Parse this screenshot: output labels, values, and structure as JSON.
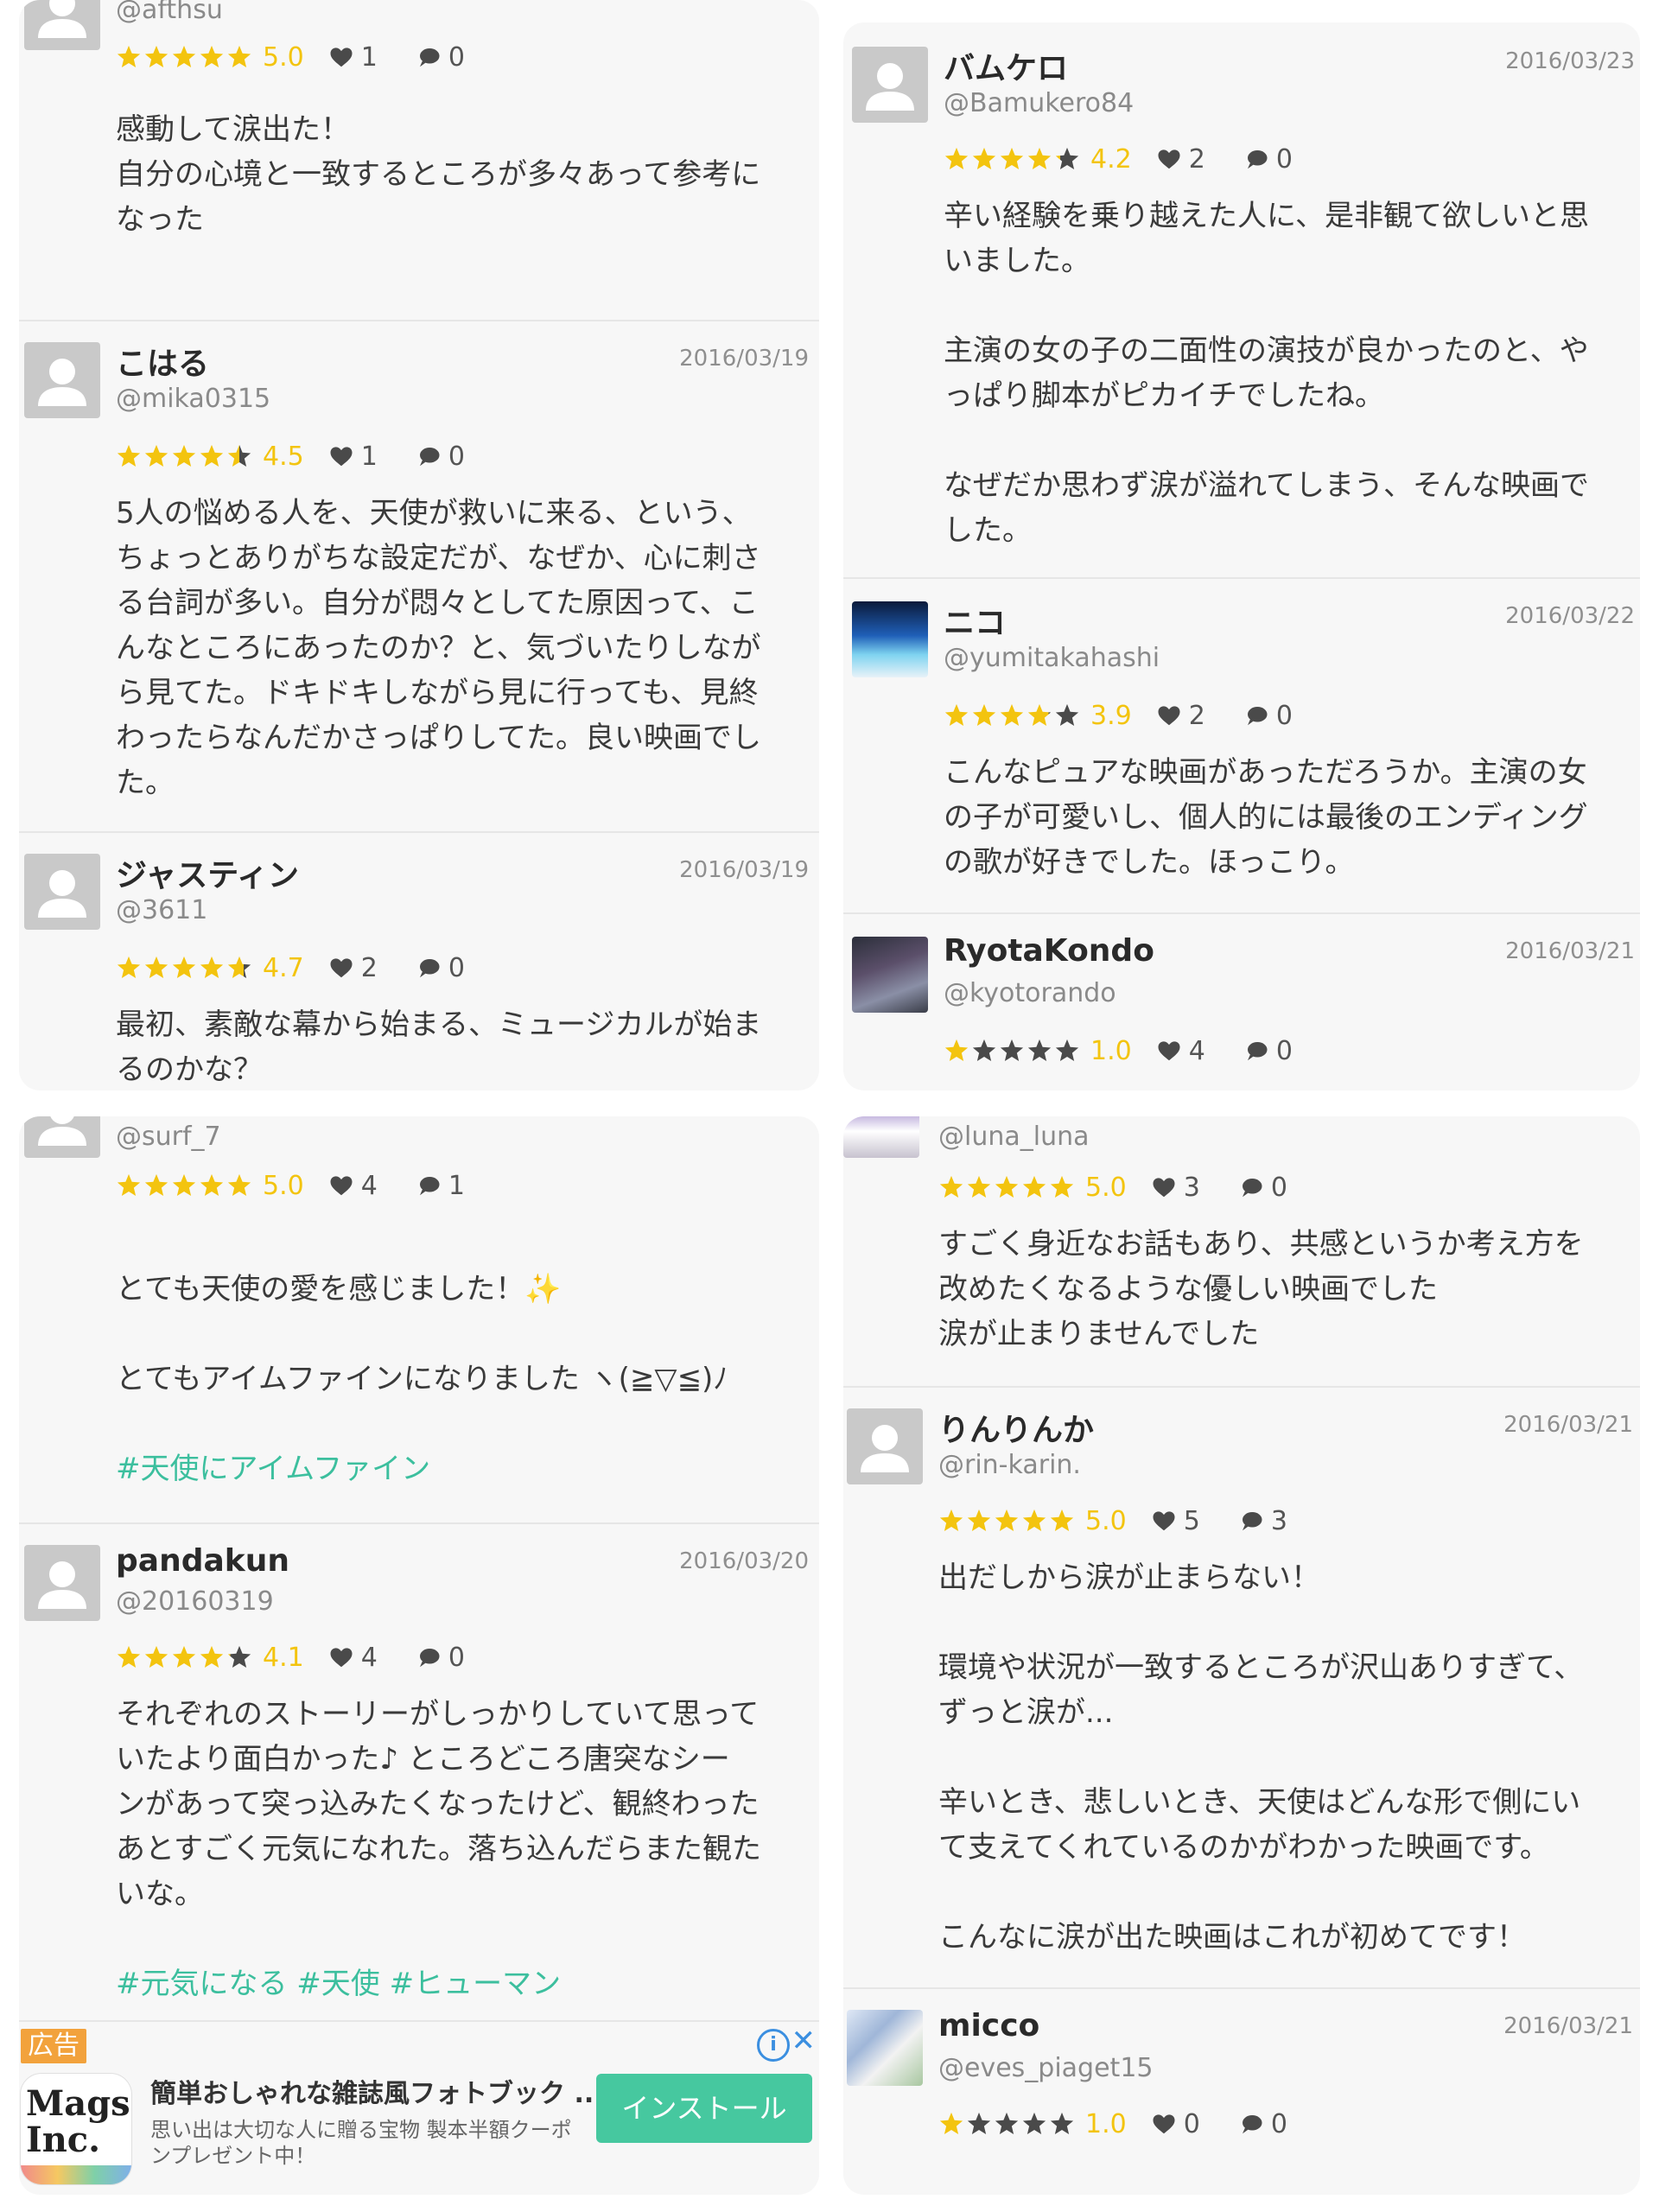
{
  "colors": {
    "star": "#f3c40f",
    "star_empty": "#4a4a4a",
    "hashtag": "#3cbf9e",
    "install": "#46c89f",
    "ad_badge": "#f2a23c"
  },
  "panels": [
    {
      "reviews": [
        {
          "handle": "@afthsu",
          "rating": 5.0,
          "score": "5.0",
          "likes": "1",
          "comments": "0",
          "body": [
            "感動して涙出た！",
            "自分の心境と一致するところが多々あって参考に",
            "なった"
          ]
        },
        {
          "name": "こはる",
          "handle": "@mika0315",
          "date": "2016/03/19",
          "rating": 4.5,
          "score": "4.5",
          "likes": "1",
          "comments": "0",
          "body": [
            "5人の悩める人を、天使が救いに来る、という、",
            "ちょっとありがちな設定だが、なぜか、心に刺さ",
            "る台詞が多い。自分が悶々としてた原因って、こ",
            "んなところにあったのか？と、気づいたりしなが",
            "ら見てた。ドキドキしながら見に行っても、見終",
            "わったらなんだかさっぱりしてた。良い映画でし",
            "た。"
          ]
        },
        {
          "name": "ジャスティン",
          "handle": "@3611",
          "date": "2016/03/19",
          "rating": 4.7,
          "score": "4.7",
          "likes": "2",
          "comments": "0",
          "body": [
            "最初、素敵な幕から始まる、ミュージカルが始ま",
            "るのかな？"
          ]
        }
      ]
    },
    {
      "reviews": [
        {
          "name": "バムケロ",
          "handle": "@Bamukero84",
          "date": "2016/03/23",
          "rating": 4.2,
          "score": "4.2",
          "likes": "2",
          "comments": "0",
          "body": [
            "辛い経験を乗り越えた人に、是非観て欲しいと思",
            "いました。",
            "",
            "主演の女の子の二面性の演技が良かったのと、や",
            "っぱり脚本がピカイチでしたね。",
            "",
            "なぜだか思わず涙が溢れてしまう、そんな映画で",
            "した。"
          ]
        },
        {
          "name": "ニコ",
          "handle": "@yumitakahashi",
          "date": "2016/03/22",
          "rating": 3.9,
          "score": "3.9",
          "likes": "2",
          "comments": "0",
          "body": [
            "こんなピュアな映画があっただろうか。主演の女",
            "の子が可愛いし、個人的には最後のエンディング",
            "の歌が好きでした。ほっこり。"
          ]
        },
        {
          "name": "RyotaKondo",
          "handle": "@kyotorando",
          "date": "2016/03/21",
          "rating": 1.0,
          "score": "1.0",
          "likes": "4",
          "comments": "0",
          "body": []
        }
      ]
    },
    {
      "reviews": [
        {
          "handle": "@surf_7",
          "rating": 5.0,
          "score": "5.0",
          "likes": "4",
          "comments": "1",
          "body": [
            "",
            "とても天使の愛を感じました！✨",
            "",
            "とてもアイムファインになりました ヽ(≧▽≦)ﾉ",
            ""
          ],
          "tags": "#天使にアイムファイン"
        },
        {
          "name": "pandakun",
          "handle": "@20160319",
          "date": "2016/03/20",
          "rating": 4.1,
          "score": "4.1",
          "likes": "4",
          "comments": "0",
          "body": [
            "それぞれのストーリーがしっかりしていて思って",
            "いたより面白かった♪ ところどころ唐突なシー",
            "ンがあって突っ込みたくなったけど、観終わった",
            "あとすごく元気になれた。落ち込んだらまた観た",
            "いな。",
            ""
          ],
          "tags": "#元気になる #天使 #ヒューマン"
        }
      ],
      "ad": {
        "badge": "広告",
        "logo": "Mags Inc.",
        "title": "簡単おしゃれな雑誌風フォトブック ...",
        "desc": "思い出は大切な人に贈る宝物 製本半額クーポンプレゼント中！",
        "button": "インストール"
      }
    },
    {
      "reviews": [
        {
          "handle": "@luna_luna",
          "rating": 5.0,
          "score": "5.0",
          "likes": "3",
          "comments": "0",
          "body": [
            "すごく身近なお話もあり、共感というか考え方を",
            "改めたくなるような優しい映画でした",
            "涙が止まりませんでした"
          ]
        },
        {
          "name": "りんりんか",
          "handle": "@rin-karin.",
          "date": "2016/03/21",
          "rating": 5.0,
          "score": "5.0",
          "likes": "5",
          "comments": "3",
          "body": [
            "出だしから涙が止まらない！",
            "",
            "環境や状況が一致するところが沢山ありすぎて、",
            "ずっと涙が...",
            "",
            "辛いとき、悲しいとき、天使はどんな形で側にい",
            "て支えてくれているのかがわかった映画です。",
            "",
            "こんなに涙が出た映画はこれが初めてです！"
          ]
        },
        {
          "name": "micco",
          "handle": "@eves_piaget15",
          "date": "2016/03/21",
          "rating": 1.0,
          "score": "1.0",
          "likes": "0",
          "comments": "0",
          "body": []
        }
      ]
    }
  ]
}
